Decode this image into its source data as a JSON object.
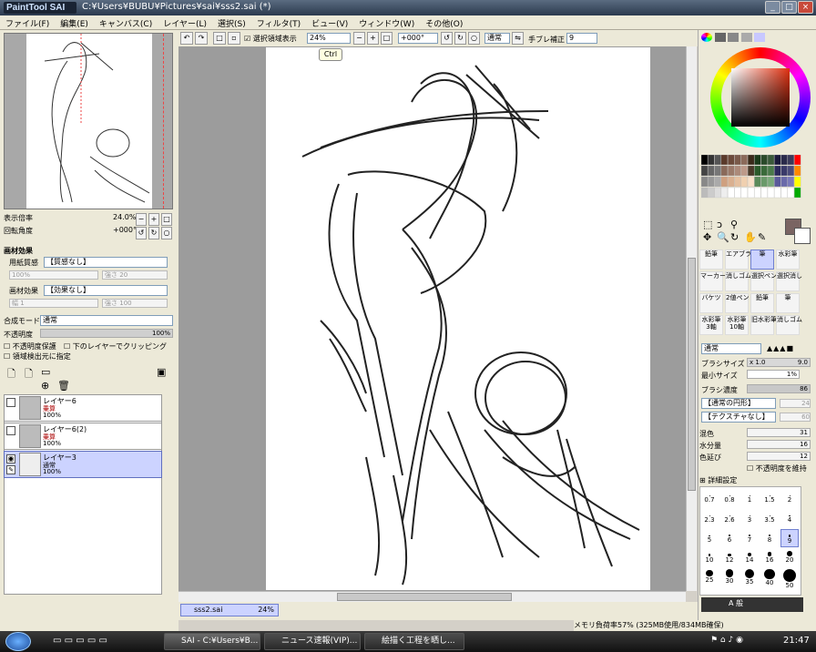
{
  "titlebar": {
    "logo": "PaintTool SAI",
    "title": "C:¥Users¥BUBU¥Pictures¥sai¥sss2.sai (*)"
  },
  "menu": [
    "ファイル(F)",
    "編集(E)",
    "キャンバス(C)",
    "レイヤー(L)",
    "選択(S)",
    "フィルタ(T)",
    "ビュー(V)",
    "ウィンドウ(W)",
    "その他(O)"
  ],
  "toolbar": {
    "selection_display": "選択領域表示",
    "zoom": "24%",
    "rotation": "+000°",
    "blend": "通常",
    "stabilizer_label": "手ブレ補正",
    "stabilizer": "9",
    "tooltip": "Ctrl"
  },
  "navigator": {
    "zoom_label": "表示倍率",
    "zoom_value": "24.0%",
    "angle_label": "回転角度",
    "angle_value": "+000°"
  },
  "texture": {
    "header": "画材効果",
    "paper_label": "用紙質感",
    "paper_value": "【質感なし】",
    "paper_pct": "100%",
    "paper_strength_label": "強さ",
    "paper_strength": "20",
    "effect_label": "画材効果",
    "effect_value": "【効果なし】",
    "width_label": "幅",
    "width_value": "1",
    "effect_strength_label": "強さ",
    "effect_strength": "100"
  },
  "layerprops": {
    "blend_label": "合成モード",
    "blend_value": "通常",
    "opacity_label": "不透明度",
    "opacity_value": "100%",
    "preserve_opacity": "不透明度保護",
    "clip": "下のレイヤーでクリッピング",
    "selection_source": "領域検出元に指定"
  },
  "layers": [
    {
      "name": "レイヤー6",
      "mode": "乗算",
      "opacity": "100%"
    },
    {
      "name": "レイヤー6(2)",
      "mode": "乗算",
      "opacity": "100%"
    },
    {
      "name": "レイヤー3",
      "mode": "通常",
      "opacity": "100%"
    }
  ],
  "document": {
    "tab": "sss2.sai",
    "zoom": "24%"
  },
  "status": {
    "memory": "メモリ負荷率57% (325MB使用/834MB確保)"
  },
  "tools": [
    "鉛筆",
    "エアブラシ",
    "筆",
    "水彩筆",
    "マーカー",
    "消しゴム",
    "選択ペン",
    "選択消し",
    "バケツ",
    "2値ペン",
    "鉛筆",
    "筆",
    "水彩筆\n3軸",
    "水彩筆\n10軸",
    "旧水彩筆",
    "消しゴム"
  ],
  "brush": {
    "mode": "通常",
    "size_label": "ブラシサイズ",
    "size_mult": "x 1.0",
    "size_value": "9.0",
    "min_label": "最小サイズ",
    "min_value": "1%",
    "density_label": "ブラシ濃度",
    "density_value": "86",
    "shape": "【通常の円形】",
    "shape_value": "24",
    "texture": "【テクスチャなし】",
    "texture_value": "60",
    "blend_label": "混色",
    "blend_value": "31",
    "water_label": "水分量",
    "water_value": "16",
    "persist_label": "色延び",
    "persist_value": "12",
    "keep_opacity": "不透明度を維持",
    "detail": "詳細設定"
  },
  "brush_sizes": [
    "0.7",
    "0.8",
    "1",
    "1.5",
    "2",
    "2.3",
    "2.6",
    "3",
    "3.5",
    "4",
    "5",
    "6",
    "7",
    "8",
    "9",
    "10",
    "12",
    "14",
    "16",
    "20",
    "25",
    "30",
    "35",
    "40",
    "50"
  ],
  "taskbar": {
    "tasks": [
      "SAI - C:¥Users¥B...",
      "ニュース速報(VIP)...",
      "絵描く工程を晒し..."
    ],
    "clock": "21:47"
  },
  "colors": {
    "accent": "#ccd3ff",
    "swatch": "#7a6462"
  }
}
